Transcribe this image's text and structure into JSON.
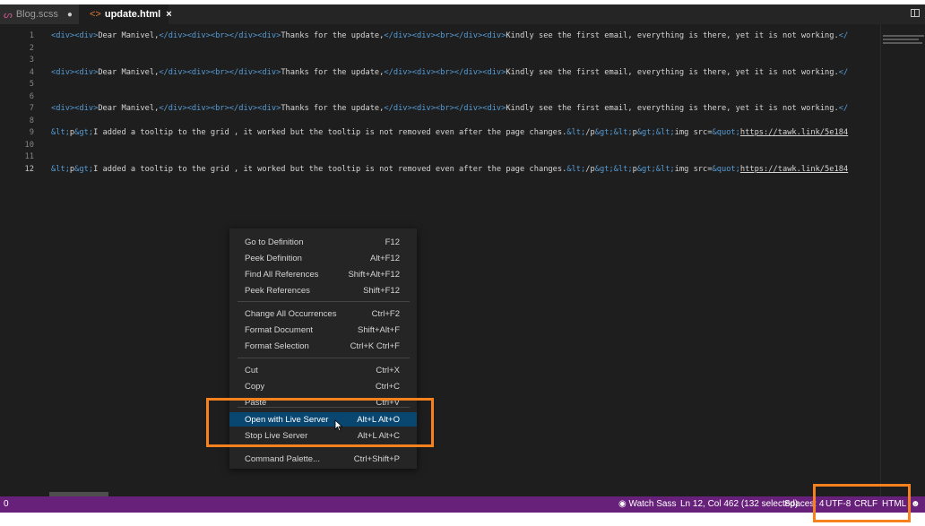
{
  "tabs": [
    {
      "label": "Blog.scss",
      "icon": "sass-file-icon",
      "modified": "●"
    },
    {
      "label": "update.html",
      "icon": "html-file-icon",
      "close": "×"
    }
  ],
  "editor": {
    "lines": [
      {
        "num": "1",
        "segments": [
          [
            "t",
            "<div><div>"
          ],
          [
            "s",
            "Dear Manivel,"
          ],
          [
            "t",
            "</div><div><br></div><div>"
          ],
          [
            "s",
            "Thanks for the update,"
          ],
          [
            "t",
            "</div><div><br></div><div>"
          ],
          [
            "s",
            "Kindly see the first email, everything is there, yet it is not working."
          ],
          [
            "t",
            "</"
          ]
        ]
      },
      {
        "num": "2",
        "segments": []
      },
      {
        "num": "3",
        "segments": []
      },
      {
        "num": "4",
        "segments": [
          [
            "t",
            "<div><div>"
          ],
          [
            "s",
            "Dear Manivel,"
          ],
          [
            "t",
            "</div><div><br></div><div>"
          ],
          [
            "s",
            "Thanks for the update,"
          ],
          [
            "t",
            "</div><div><br></div><div>"
          ],
          [
            "s",
            "Kindly see the first email, everything is there, yet it is not working."
          ],
          [
            "t",
            "</"
          ]
        ]
      },
      {
        "num": "5",
        "segments": []
      },
      {
        "num": "6",
        "segments": []
      },
      {
        "num": "7",
        "segments": [
          [
            "t",
            "<div><div>"
          ],
          [
            "s",
            "Dear Manivel,"
          ],
          [
            "t",
            "</div><div><br></div><div>"
          ],
          [
            "s",
            "Thanks for the update,"
          ],
          [
            "t",
            "</div><div><br></div><div>"
          ],
          [
            "s",
            "Kindly see the first email, everything is there, yet it is not working."
          ],
          [
            "t",
            "</"
          ]
        ]
      },
      {
        "num": "8",
        "segments": []
      },
      {
        "num": "9",
        "segments": [
          [
            "k",
            "&lt;"
          ],
          [
            "s",
            "p"
          ],
          [
            "k",
            "&gt;"
          ],
          [
            "s",
            "I added a tooltip to the grid , it worked but the tooltip is not removed even after the page changes."
          ],
          [
            "k",
            "&lt;"
          ],
          [
            "s",
            "/p"
          ],
          [
            "k",
            "&gt;&lt;"
          ],
          [
            "s",
            "p"
          ],
          [
            "k",
            "&gt;&lt;"
          ],
          [
            "s",
            "img src="
          ],
          [
            "k",
            "&quot;"
          ],
          [
            "u",
            "https://tawk.link/5e184"
          ]
        ]
      },
      {
        "num": "10",
        "segments": []
      },
      {
        "num": "11",
        "segments": []
      },
      {
        "num": "12",
        "segments": [
          [
            "k",
            "&lt;"
          ],
          [
            "s",
            "p"
          ],
          [
            "k",
            "&gt;"
          ],
          [
            "s",
            "I added a tooltip to the grid , it worked but the tooltip is not removed even after the page changes."
          ],
          [
            "k",
            "&lt;"
          ],
          [
            "s",
            "/p"
          ],
          [
            "k",
            "&gt;&lt;"
          ],
          [
            "s",
            "p"
          ],
          [
            "k",
            "&gt;&lt;"
          ],
          [
            "s",
            "img src="
          ],
          [
            "k",
            "&quot;"
          ],
          [
            "u",
            "https://tawk.link/5e184"
          ]
        ]
      }
    ],
    "active_line": "12"
  },
  "context_menu": {
    "items": [
      {
        "label": "Go to Definition",
        "shortcut": "F12"
      },
      {
        "label": "Peek Definition",
        "shortcut": "Alt+F12"
      },
      {
        "label": "Find All References",
        "shortcut": "Shift+Alt+F12"
      },
      {
        "label": "Peek References",
        "shortcut": "Shift+F12"
      },
      {
        "label": "Change All Occurrences",
        "shortcut": "Ctrl+F2"
      },
      {
        "label": "Format Document",
        "shortcut": "Shift+Alt+F"
      },
      {
        "label": "Format Selection",
        "shortcut": "Ctrl+K Ctrl+F"
      },
      {
        "label": "Cut",
        "shortcut": "Ctrl+X"
      },
      {
        "label": "Copy",
        "shortcut": "Ctrl+C"
      },
      {
        "label": "Paste",
        "shortcut": "Ctrl+V"
      },
      {
        "label": "Open with Live Server",
        "shortcut": "Alt+L Alt+O",
        "selected": true
      },
      {
        "label": "Stop Live Server",
        "shortcut": "Alt+L Alt+C"
      },
      {
        "label": "Command Palette...",
        "shortcut": "Ctrl+Shift+P"
      }
    ]
  },
  "statusbar": {
    "left": "0",
    "watch_sass": "Watch Sass",
    "watch_icon": "eye-icon",
    "position": "Ln 12, Col 462 (132 selected)",
    "spaces": "Spaces: 4",
    "encoding": "UTF-8",
    "eol": "CRLF",
    "language": "HTML",
    "feedback_icon": "smiley-icon"
  },
  "colors": {
    "statusbar": "#68217a",
    "highlight": "#f5821f",
    "menu_selected": "#094771",
    "tag": "#569cd6"
  }
}
